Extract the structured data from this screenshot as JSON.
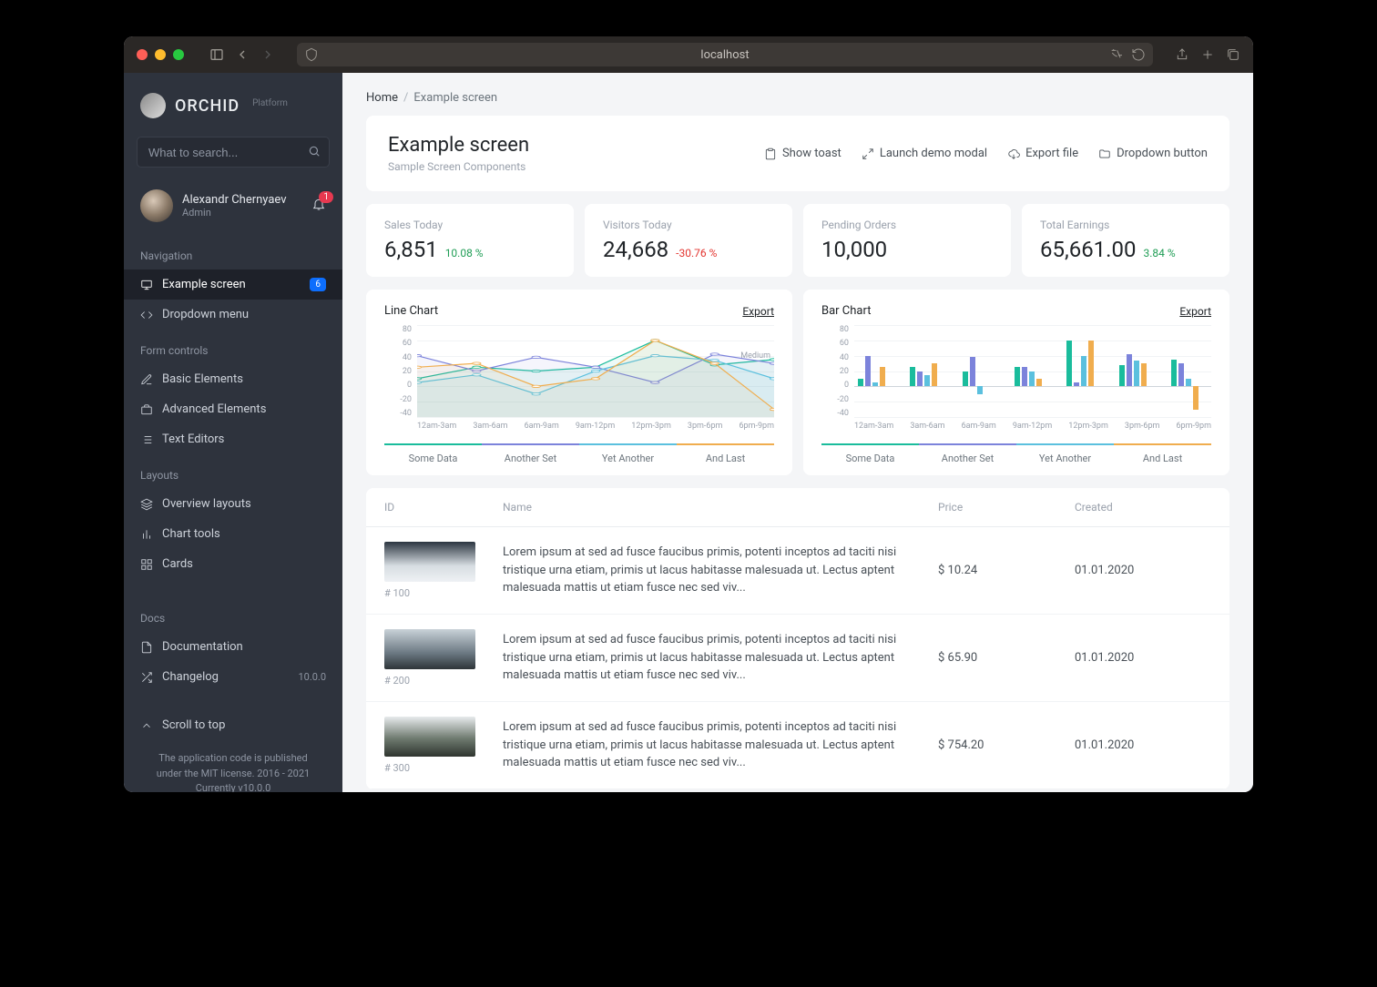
{
  "browser": {
    "url": "localhost"
  },
  "sidebar": {
    "brand": "ORCHID",
    "brand_sub": "Platform",
    "search_placeholder": "What to search...",
    "user": {
      "name": "Alexandr Chernyaev",
      "role": "Admin"
    },
    "notifications_count": "1",
    "sections": {
      "navigation": "Navigation",
      "form_controls": "Form controls",
      "layouts": "Layouts",
      "docs": "Docs"
    },
    "items": {
      "example": {
        "label": "Example screen",
        "badge": "6"
      },
      "dropdown": {
        "label": "Dropdown menu"
      },
      "basic": {
        "label": "Basic Elements"
      },
      "advanced": {
        "label": "Advanced Elements"
      },
      "text": {
        "label": "Text Editors"
      },
      "overview": {
        "label": "Overview layouts"
      },
      "charts": {
        "label": "Chart tools"
      },
      "cards": {
        "label": "Cards"
      },
      "documentation": {
        "label": "Documentation"
      },
      "changelog": {
        "label": "Changelog",
        "right": "10.0.0"
      },
      "scroll_top": {
        "label": "Scroll to top"
      }
    },
    "footer": {
      "line1": "The application code is published",
      "line2": "under the MIT license. 2016 - 2021",
      "line3": "Currently v10.0.0"
    }
  },
  "breadcrumb": {
    "home": "Home",
    "current": "Example screen"
  },
  "hero": {
    "title": "Example screen",
    "subtitle": "Sample Screen Components",
    "actions": {
      "toast": "Show toast",
      "modal": "Launch demo modal",
      "export": "Export file",
      "dropdown": "Dropdown button"
    }
  },
  "stats": [
    {
      "label": "Sales Today",
      "value": "6,851",
      "delta": "10.08 %",
      "dir": "up"
    },
    {
      "label": "Visitors Today",
      "value": "24,668",
      "delta": "-30.76 %",
      "dir": "down"
    },
    {
      "label": "Pending Orders",
      "value": "10,000",
      "delta": "",
      "dir": ""
    },
    {
      "label": "Total Earnings",
      "value": "65,661.00",
      "delta": "3.84 %",
      "dir": "up"
    }
  ],
  "charts": {
    "line": {
      "title": "Line Chart",
      "export": "Export"
    },
    "bar": {
      "title": "Bar Chart",
      "export": "Export"
    },
    "xlabels": [
      "12am-3am",
      "3am-6am",
      "6am-9am",
      "9am-12pm",
      "12pm-3pm",
      "3pm-6pm",
      "6pm-9pm"
    ],
    "ylabels": [
      "80",
      "60",
      "40",
      "20",
      "0",
      "-20",
      "-40"
    ],
    "annotation": "Medium",
    "legend": [
      "Some Data",
      "Another Set",
      "Yet Another",
      "And Last"
    ]
  },
  "table": {
    "headers": {
      "id": "ID",
      "name": "Name",
      "price": "Price",
      "created": "Created"
    },
    "rows": [
      {
        "id": "# 100",
        "name": "Lorem ipsum at sed ad fusce faucibus primis, potenti inceptos ad taciti nisi tristique urna etiam, primis ut lacus habitasse malesuada ut. Lectus aptent malesuada mattis ut etiam fusce nec sed viv...",
        "price": "$ 10.24",
        "created": "01.01.2020"
      },
      {
        "id": "# 200",
        "name": "Lorem ipsum at sed ad fusce faucibus primis, potenti inceptos ad taciti nisi tristique urna etiam, primis ut lacus habitasse malesuada ut. Lectus aptent malesuada mattis ut etiam fusce nec sed viv...",
        "price": "$ 65.90",
        "created": "01.01.2020"
      },
      {
        "id": "# 300",
        "name": "Lorem ipsum at sed ad fusce faucibus primis, potenti inceptos ad taciti nisi tristique urna etiam, primis ut lacus habitasse malesuada ut. Lectus aptent malesuada mattis ut etiam fusce nec sed viv...",
        "price": "$ 754.20",
        "created": "01.01.2020"
      }
    ]
  },
  "chart_data": [
    {
      "type": "line",
      "title": "Line Chart",
      "xlabel": "",
      "ylabel": "",
      "ylim": [
        -40,
        80
      ],
      "categories": [
        "12am-3am",
        "3am-6am",
        "6am-9am",
        "9am-12pm",
        "12pm-3pm",
        "3pm-6pm",
        "6pm-9pm"
      ],
      "series": [
        {
          "name": "Some Data",
          "values": [
            10,
            25,
            20,
            25,
            60,
            28,
            35
          ]
        },
        {
          "name": "Another Set",
          "values": [
            40,
            20,
            38,
            25,
            5,
            42,
            30
          ]
        },
        {
          "name": "Yet Another",
          "values": [
            5,
            15,
            -10,
            20,
            40,
            34,
            10
          ]
        },
        {
          "name": "And Last",
          "values": [
            25,
            30,
            0,
            10,
            60,
            30,
            -30
          ]
        }
      ],
      "annotation": "Medium"
    },
    {
      "type": "bar",
      "title": "Bar Chart",
      "xlabel": "",
      "ylabel": "",
      "ylim": [
        -40,
        80
      ],
      "categories": [
        "12am-3am",
        "3am-6am",
        "6am-9am",
        "9am-12pm",
        "12pm-3pm",
        "3pm-6pm",
        "6pm-9pm"
      ],
      "series": [
        {
          "name": "Some Data",
          "values": [
            10,
            25,
            20,
            25,
            60,
            28,
            35
          ]
        },
        {
          "name": "Another Set",
          "values": [
            40,
            20,
            38,
            25,
            5,
            42,
            30
          ]
        },
        {
          "name": "Yet Another",
          "values": [
            5,
            15,
            -10,
            20,
            40,
            34,
            10
          ]
        },
        {
          "name": "And Last",
          "values": [
            25,
            30,
            0,
            10,
            60,
            30,
            -30
          ]
        }
      ]
    }
  ],
  "colors": {
    "series": [
      "#1abc9c",
      "#7c83db",
      "#5bc0de",
      "#f0ad4e"
    ]
  }
}
